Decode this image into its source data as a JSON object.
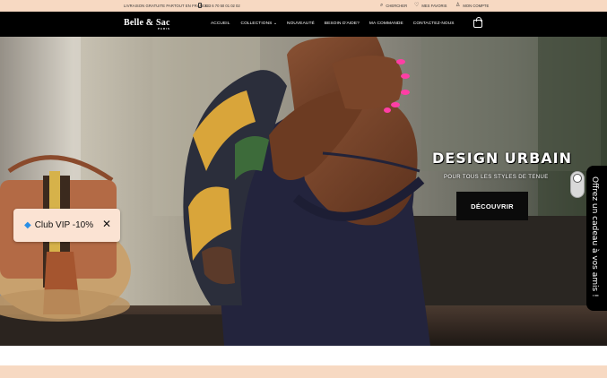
{
  "topbar": {
    "shipping": "LIVRAISON GRATUITE PARTOUT EN FRANCE",
    "phone": "+33 6 70 50 01 02 02",
    "search": "CHERCHER",
    "favorites": "MES FAVORIS",
    "account": "MON COMPTE"
  },
  "header": {
    "logo": "Belle & Sac",
    "logo_sub": "PARIS",
    "menu": [
      "ACCUEIL",
      "COLLECTIONS ⌄",
      "NOUVEAUTÉ",
      "BESOIN D'AIDE?",
      "MA COMMANDE",
      "CONTACTEZ-NOUS"
    ]
  },
  "hero": {
    "title": "DESIGN URBAIN",
    "subtitle": "POUR TOUS LES STYLES DE TENUE",
    "cta": "DÉCOUVRIR"
  },
  "vip_popup": {
    "label": "Club VIP -10%",
    "close": "✕"
  },
  "gift_tab": {
    "label": "Offrez un cadeau à vos amis !"
  },
  "colors": {
    "topbar_bg": "#f7d9c2",
    "nav_bg": "#000000",
    "cta_bg": "#0b0b0b",
    "vip_bg": "#fbe3d3"
  },
  "icons": {
    "phone": "phone-icon",
    "search": "search-icon",
    "favorites": "heart-icon",
    "account": "user-icon",
    "cart": "bag-icon",
    "gem": "gem-icon",
    "close": "close-icon"
  }
}
